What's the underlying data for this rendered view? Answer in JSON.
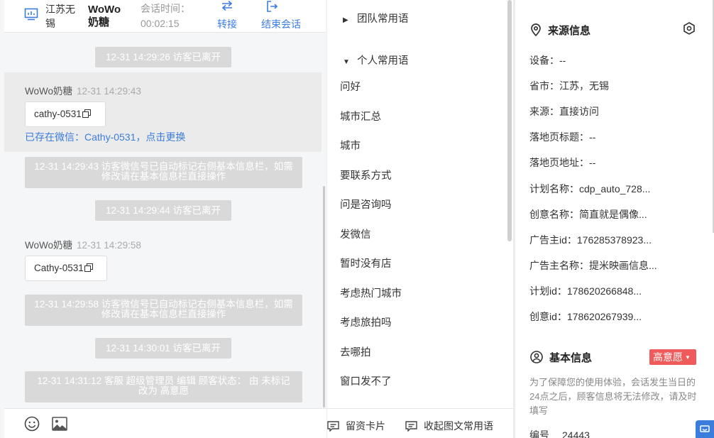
{
  "header": {
    "region": "江苏无锡",
    "name": "WoWo奶糖",
    "time_label": "会话时间：",
    "time_value": "00:02:15",
    "transfer_label": "转接",
    "end_label": "结束会话"
  },
  "messages": {
    "sys1": "12-31 14:29:26 访客已离开",
    "m1_sender": "WoWo奶糖",
    "m1_time": "12-31 14:29:43",
    "m1_wechat": "cathy-0531",
    "m1_link": "已存在微信：Cathy-0531，点击更换",
    "sys2": "12-31 14:29:43 访客微信号已自动标记右侧基本信息栏，如需修改请在基本信息栏直接操作",
    "sys3": "12-31 14:29:44 访客已离开",
    "m2_sender": "WoWo奶糖",
    "m2_time": "12-31 14:29:58",
    "m2_wechat": "Cathy-0531",
    "sys4": "12-31 14:29:58 访客微信号已自动标记右侧基本信息栏，如需修改请在基本信息栏直接操作",
    "sys5": "12-31 14:30:01 访客已离开",
    "sys6": "12-31 14:31:12 客服 超级管理员 编辑 顾客状态： 由 未标记 改为 高意愿"
  },
  "phrases": {
    "team_group": "团队常用语",
    "personal_group": "个人常用语",
    "items": [
      "问好",
      "城市汇总",
      "城市",
      "要联系方式",
      "问是咨询吗",
      "发微信",
      "暂时没有店",
      "考虑热门城市",
      "考虑旅拍吗",
      "去哪拍",
      "窗口发不了"
    ],
    "footer_card": "留资卡片",
    "footer_collapse": "收起图文常用语"
  },
  "source_info": {
    "title": "来源信息",
    "rows": [
      "设备：--",
      "省市：江苏，无锡",
      "来源：直接访问",
      "落地页标题：--",
      "落地页地址：--",
      "计划名称：cdp_auto_728...",
      "创意名称：简直就是偶像...",
      "广告主id：176285378923...",
      "广告主名称：提米映画信息...",
      "计划id：178620266848...",
      "创意id：178620267939..."
    ]
  },
  "basic_info": {
    "title": "基本信息",
    "status": "高意愿",
    "notice": "为了保障您的使用体验，会话发生当日的24点之后，顾客信息将无法修改，请及时填写",
    "code_label": "编号",
    "code_value": "24443"
  },
  "colors": {
    "accent": "#3b7ddd",
    "badge": "#f05a5a",
    "system_bubble": "#d9d9d9"
  }
}
